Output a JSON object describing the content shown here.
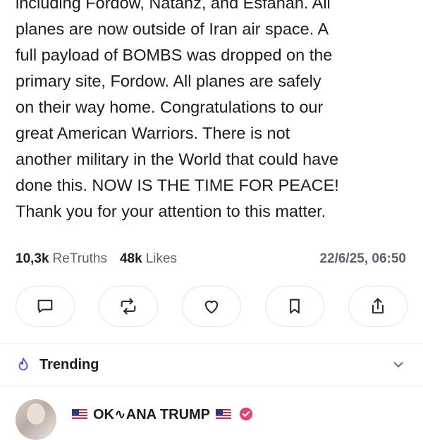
{
  "post": {
    "lines": [
      "including Fordow, Natanz, and Esfahan. All",
      "planes are now outside of Iran air space. A",
      "full payload of BOMBS was dropped on the",
      "primary site, Fordow. All planes are safely",
      "on their way home. Congratulations to our",
      "great American Warriors. There is not",
      "another military in the World that could have",
      "done this. NOW IS THE TIME FOR PEACE!",
      "Thank you for your attention to this matter."
    ]
  },
  "stats": {
    "retruths_count": "10,3k",
    "retruths_label": "ReTruths",
    "likes_count": "48k",
    "likes_label": "Likes",
    "timestamp": "22/6/25, 06:50"
  },
  "actions": {
    "icons": [
      "comment-icon",
      "retruth-icon",
      "heart-icon",
      "bookmark-icon",
      "share-icon"
    ]
  },
  "trending": {
    "label": "Trending",
    "icon": "flame-icon",
    "accent": "#5b4fe0"
  },
  "next_post": {
    "display_name": "OK∿ANA TRUMP",
    "verified_color": "#e8436f"
  }
}
